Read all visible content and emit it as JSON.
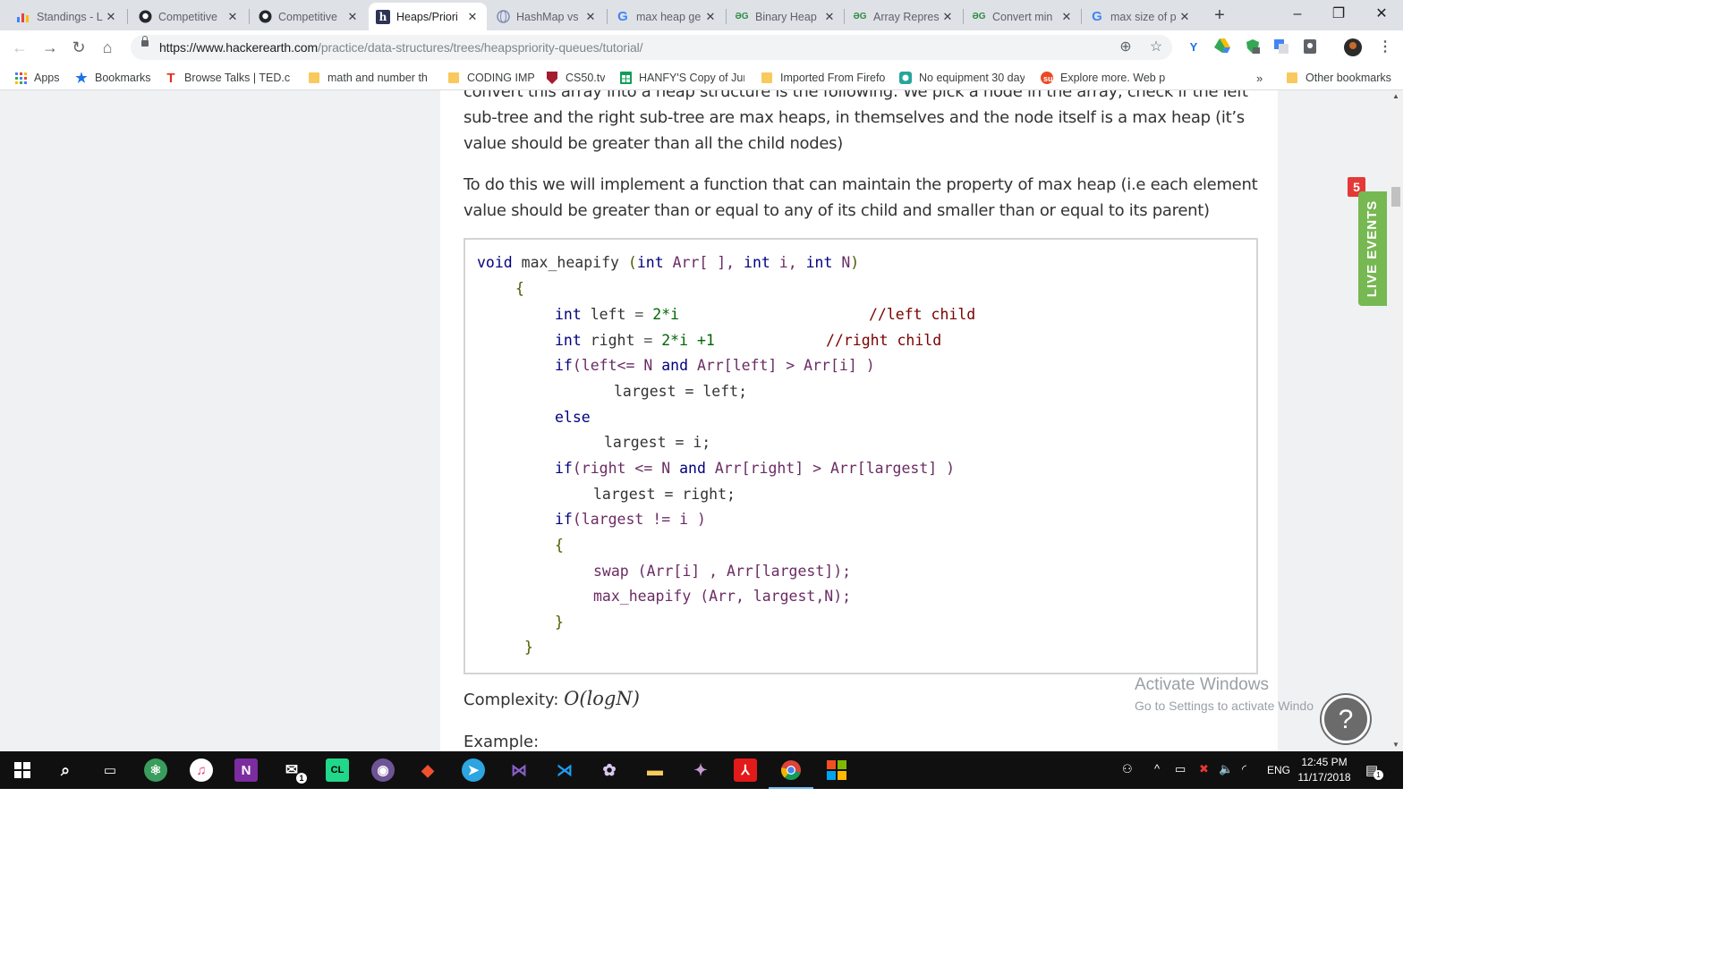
{
  "browser": {
    "tabs": [
      {
        "title": "Standings - L",
        "icon": "bar-chart-icon",
        "active": false
      },
      {
        "title": "Competitive",
        "icon": "github-icon",
        "active": false
      },
      {
        "title": "Competitive",
        "icon": "github-icon",
        "active": false
      },
      {
        "title": "Heaps/Priori",
        "icon": "hackerearth-icon",
        "active": true
      },
      {
        "title": "HashMap vs",
        "icon": "globe-icon",
        "active": false
      },
      {
        "title": "max heap ge",
        "icon": "google-icon",
        "active": false
      },
      {
        "title": "Binary Heap",
        "icon": "gfg-icon",
        "active": false
      },
      {
        "title": "Array Repres",
        "icon": "gfg-icon",
        "active": false
      },
      {
        "title": "Convert min",
        "icon": "gfg-icon",
        "active": false
      },
      {
        "title": "max size of p",
        "icon": "google-icon",
        "active": false
      }
    ],
    "url_host": "https://www.hackerearth.com",
    "url_path": "/practice/data-structures/trees/heapspriority-queues/tutorial/",
    "bookmarks": [
      {
        "label": "Apps",
        "icon": "apps-grid-icon"
      },
      {
        "label": "Bookmarks",
        "icon": "star-icon"
      },
      {
        "label": "Browse Talks | TED.co",
        "icon": "ted-icon"
      },
      {
        "label": "math and number th",
        "icon": "folder-icon"
      },
      {
        "label": "CODING IMP",
        "icon": "folder-icon"
      },
      {
        "label": "CS50.tv",
        "icon": "harvard-shield-icon"
      },
      {
        "label": "HANFY'S Copy of Jun",
        "icon": "sheets-icon"
      },
      {
        "label": "Imported From Firefo",
        "icon": "folder-icon"
      },
      {
        "label": "No equipment 30 day",
        "icon": "app-icon"
      },
      {
        "label": "Explore more. Web p",
        "icon": "stumble-icon"
      }
    ],
    "bookmarks_overflow": "»",
    "other_bookmarks": "Other bookmarks"
  },
  "article": {
    "cut_line": "convert this array into a heap structure is the following: We pick a node in the array, check if the left",
    "para1_l1": "sub-tree and the right sub-tree are max heaps, in themselves and the node itself is a max heap (it’s",
    "para1_l2": "value should be greater than all the child nodes)",
    "para2_l1": "To do this we will implement a function that can maintain the property of max heap (i.e each element",
    "para2_l2": "value should be greater than or equal to any of its child and smaller than or equal to its parent)",
    "complexity_label": "Complexity:",
    "complexity_value": "O(logN)",
    "example_label": "Example:"
  },
  "code": {
    "l1": {
      "kw": "void",
      "fn": " max_heapify ",
      "p1": "(",
      "t1": "int",
      "v1": " Arr[ ], ",
      "t2": "int",
      "v2": " i, ",
      "t3": "int",
      "v3": " N",
      "p2": ")"
    },
    "l2": "{",
    "l3": {
      "t": "int",
      "rest": " left ",
      "op": "=",
      "num": " 2*i",
      "cm": "//left child"
    },
    "l4": {
      "t": "int",
      "rest": " right ",
      "op": "=",
      "num": " 2*i +1",
      "cm": "//right child"
    },
    "l5": {
      "kw": "if",
      "rest": "(left<= N ",
      "and": "and",
      "rest2": " Arr[left] > Arr[i] )"
    },
    "l6": "largest = left;",
    "l7": "else",
    "l8": "largest = i;",
    "l9": {
      "kw": "if",
      "rest": "(right <= N ",
      "and": "and",
      "rest2": " Arr[right] > Arr[largest] )"
    },
    "l10": "largest = right;",
    "l11": {
      "kw": "if",
      "rest": "(largest != i )"
    },
    "l12": "{",
    "l13": "swap (Arr[i] , Arr[largest]);",
    "l14": "max_heapify (Arr, largest,N);",
    "l15": "}",
    "l16": "}"
  },
  "live_events": {
    "label": "LIVE EVENTS",
    "badge": "5"
  },
  "watermark": {
    "line1": "Activate Windows",
    "line2": "Go to Settings to activate Windo"
  },
  "help": "?",
  "taskbar": {
    "lang": "ENG",
    "time": "12:45 PM",
    "date": "11/17/2018",
    "notif_count": "1",
    "mail_badge": "1"
  },
  "colors": {
    "accent_green": "#76b852",
    "badge_red": "#e53935",
    "taskbar": "#101010"
  }
}
